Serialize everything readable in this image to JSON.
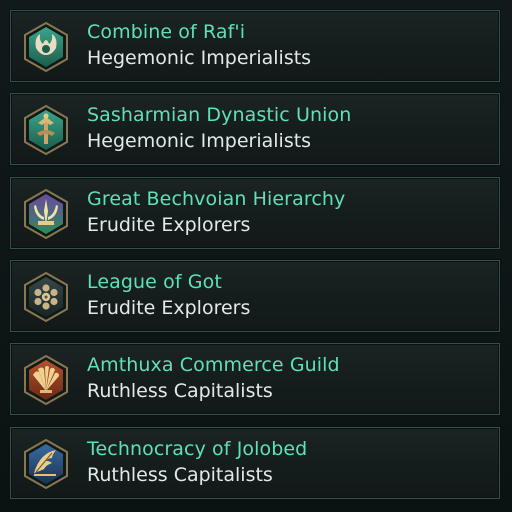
{
  "empires": [
    {
      "name": "Combine of Raf'i",
      "ethic": "Hegemonic Imperialists",
      "emblem_icon": "horned-crest-icon",
      "emblem_color": "#2f8a73"
    },
    {
      "name": "Sasharmian Dynastic Union",
      "ethic": "Hegemonic Imperialists",
      "emblem_icon": "scepter-crest-icon",
      "emblem_color": "#2f8a73"
    },
    {
      "name": "Great Bechvoian Hierarchy",
      "ethic": "Erudite Explorers",
      "emblem_icon": "trident-crest-icon",
      "emblem_color": "#5a3a8a"
    },
    {
      "name": "League of Got",
      "ethic": "Erudite Explorers",
      "emblem_icon": "orb-cluster-icon",
      "emblem_color": "#2a3a3a"
    },
    {
      "name": "Amthuxa Commerce Guild",
      "ethic": "Ruthless Capitalists",
      "emblem_icon": "shell-fan-icon",
      "emblem_color": "#8a3a22"
    },
    {
      "name": "Technocracy of Jolobed",
      "ethic": "Ruthless Capitalists",
      "emblem_icon": "feather-wing-icon",
      "emblem_color": "#2c4f7a"
    }
  ],
  "colors": {
    "name_text": "#5fe0b9",
    "ethic_text": "#e4e8e7",
    "border": "#35514a"
  }
}
